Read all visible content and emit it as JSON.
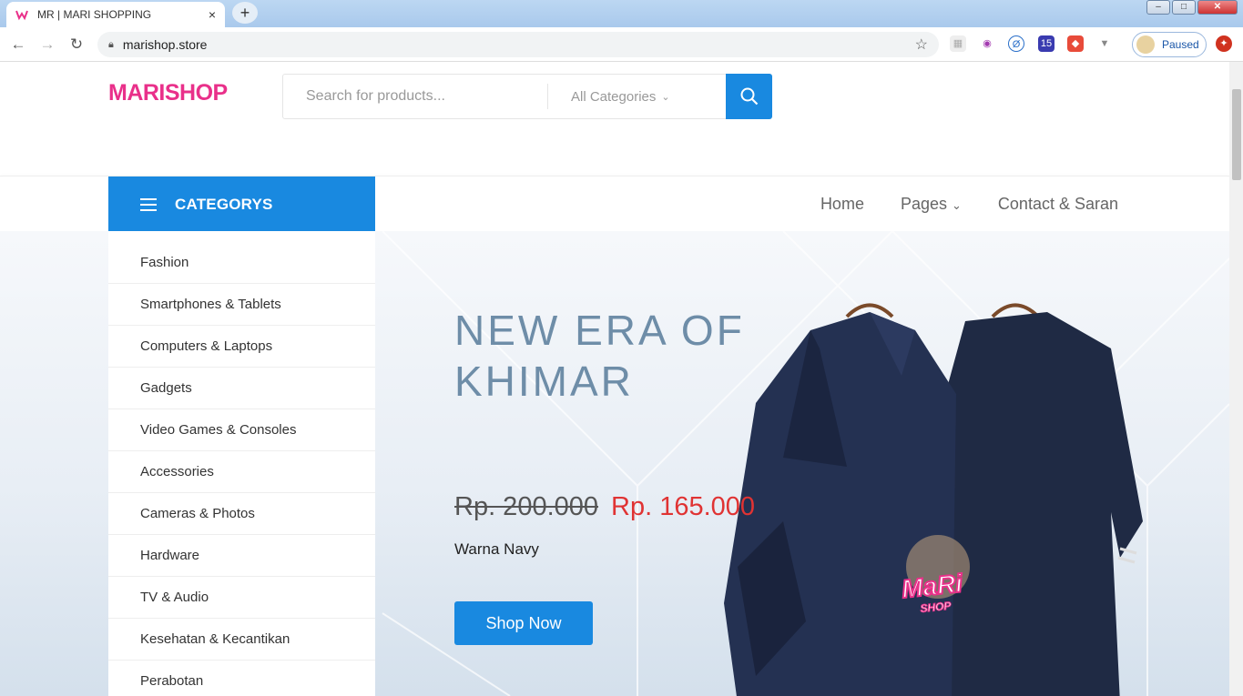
{
  "browser": {
    "tab_title": "MR | MARI SHOPPING",
    "tab_close": "×",
    "new_tab": "+",
    "url": "marishop.store",
    "profile_status": "Paused",
    "extension_badge": "15"
  },
  "header": {
    "logo_text": "MARISHOP",
    "search_placeholder": "Search for products...",
    "category_select": "All Categories"
  },
  "nav": {
    "categories_label": "CATEGORYS",
    "menu": [
      "Home",
      "Pages",
      "Contact & Saran"
    ]
  },
  "categories": [
    "Fashion",
    "Smartphones & Tablets",
    "Computers & Laptops",
    "Gadgets",
    "Video Games & Consoles",
    "Accessories",
    "Cameras & Photos",
    "Hardware",
    "TV & Audio",
    "Kesehatan & Kecantikan",
    "Perabotan"
  ],
  "hero": {
    "headline_line1": "NEW ERA OF",
    "headline_line2": "KHIMAR",
    "old_price": "Rp. 200.000",
    "new_price": "Rp. 165.000",
    "color_text": "Warna Navy",
    "cta_label": "Shop Now",
    "watermark_line1": "MaRi",
    "watermark_line2": "SHOP"
  },
  "colors": {
    "accent": "#1989e0",
    "price_red": "#e03333",
    "headline": "#6e8da8",
    "product_navy": "#1f2a44"
  }
}
